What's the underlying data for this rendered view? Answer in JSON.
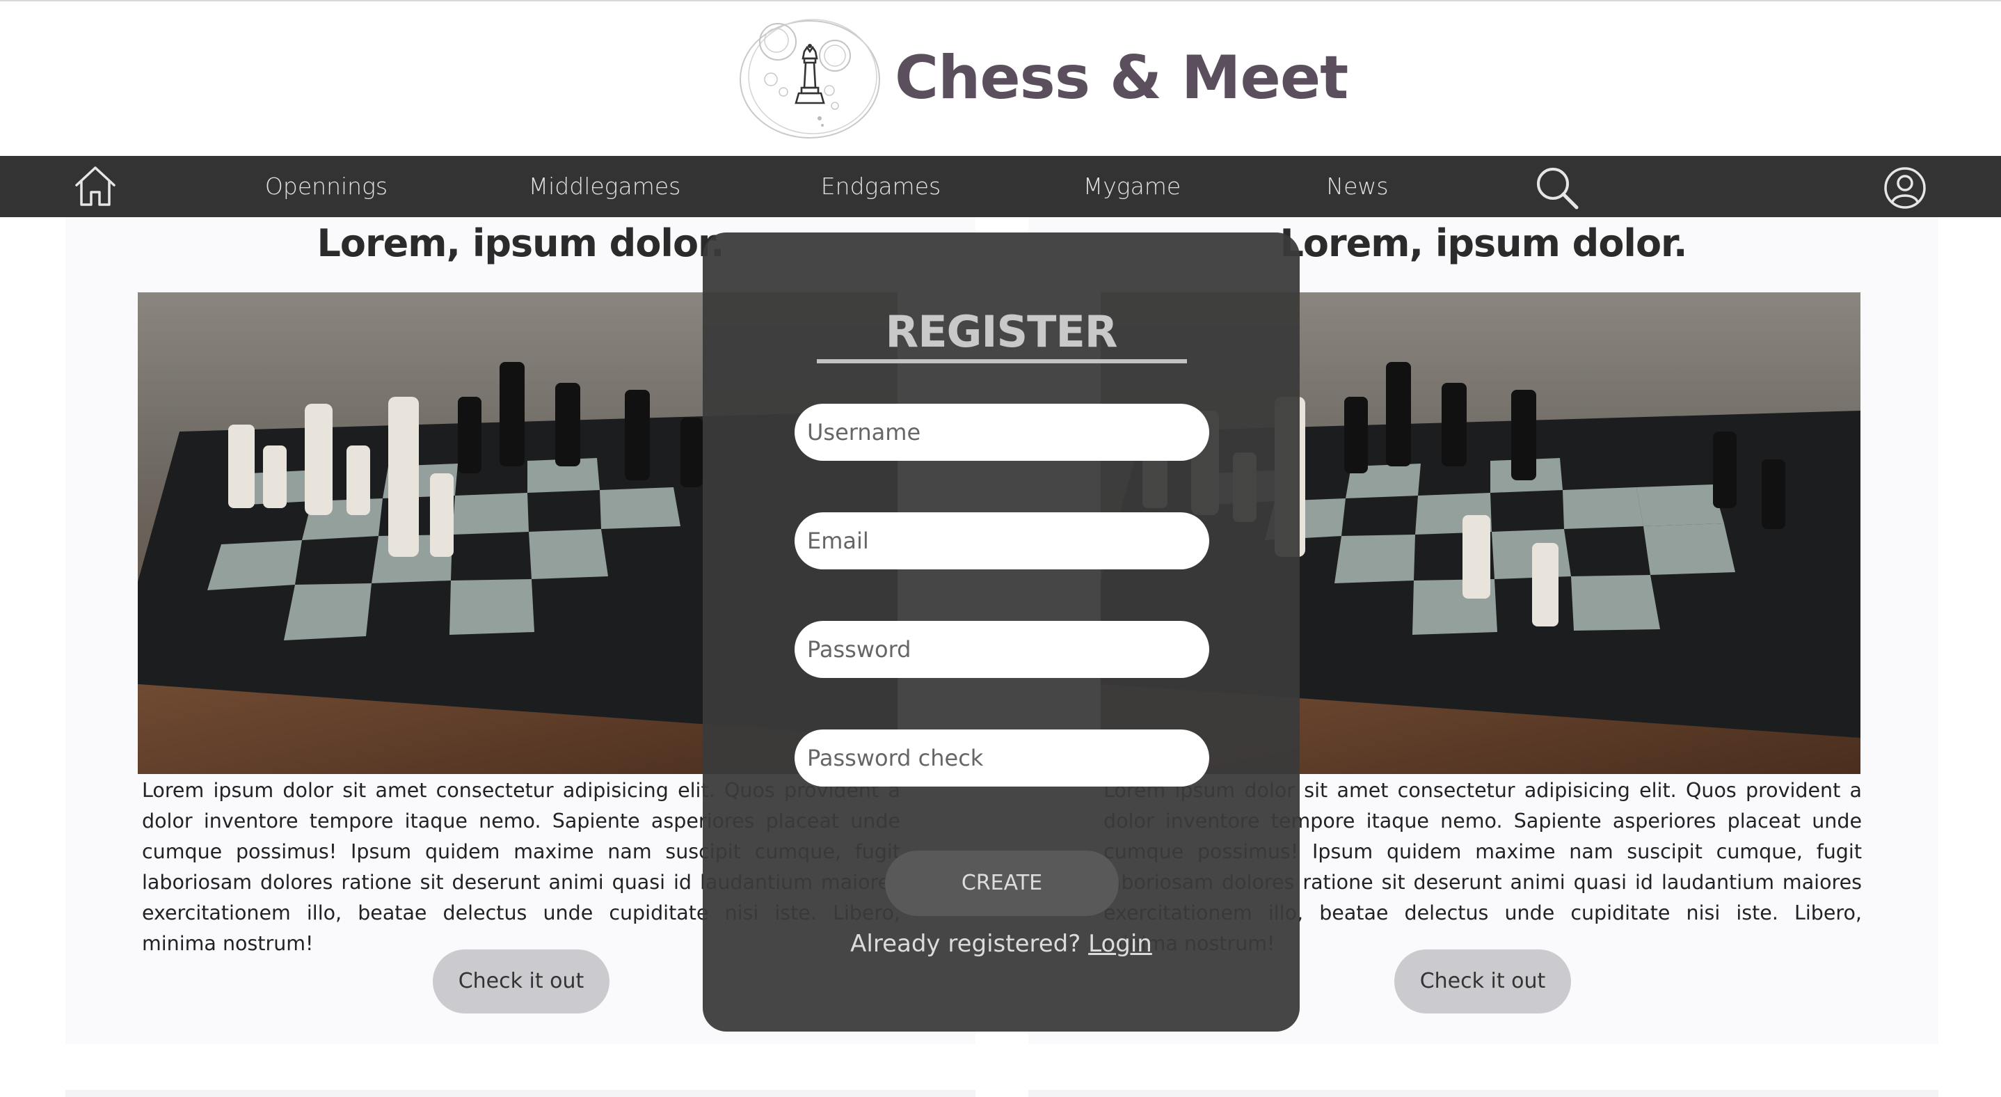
{
  "header": {
    "title": "Chess & Meet"
  },
  "nav": {
    "items": [
      {
        "label": "Opennings"
      },
      {
        "label": "Middlegames"
      },
      {
        "label": "Endgames"
      },
      {
        "label": "Mygame"
      },
      {
        "label": "News"
      }
    ],
    "icons": [
      "home-icon",
      "search-icon",
      "user-icon"
    ]
  },
  "cards": [
    {
      "title": "Lorem, ipsum dolor.",
      "text": "Lorem ipsum dolor sit amet consectetur adipisicing elit. Quos provident a dolor inventore tempore itaque nemo. Sapiente asperiores placeat unde cumque possimus! Ipsum quidem maxime nam suscipit cumque, fugit laboriosam dolores ratione sit deserunt animi quasi id laudantium maiores exercitationem illo, beatae delectus unde cupiditate nisi iste. Libero, minima nostrum!",
      "button": "Check it out"
    },
    {
      "title": "Lorem, ipsum dolor.",
      "text": "Lorem ipsum dolor sit amet consectetur adipisicing elit. Quos provident a dolor inventore tempore itaque nemo. Sapiente asperiores placeat unde cumque possimus! Ipsum quidem maxime nam suscipit cumque, fugit laboriosam dolores ratione sit deserunt animi quasi id laudantium maiores exercitationem illo, beatae delectus unde cupiditate nisi iste. Libero, minima nostrum!",
      "button": "Check it out"
    }
  ],
  "register": {
    "title": "REGISTER",
    "username_placeholder": "Username",
    "email_placeholder": "Email",
    "password_placeholder": "Password",
    "password_check_placeholder": "Password check",
    "create_label": "CREATE",
    "already_text": "Already registered?",
    "login_link": "Login"
  },
  "colors": {
    "navbar": "#333333",
    "brand": "#5b4f5e",
    "modal": "#3a3a3a",
    "button": "#cbcbcf"
  }
}
